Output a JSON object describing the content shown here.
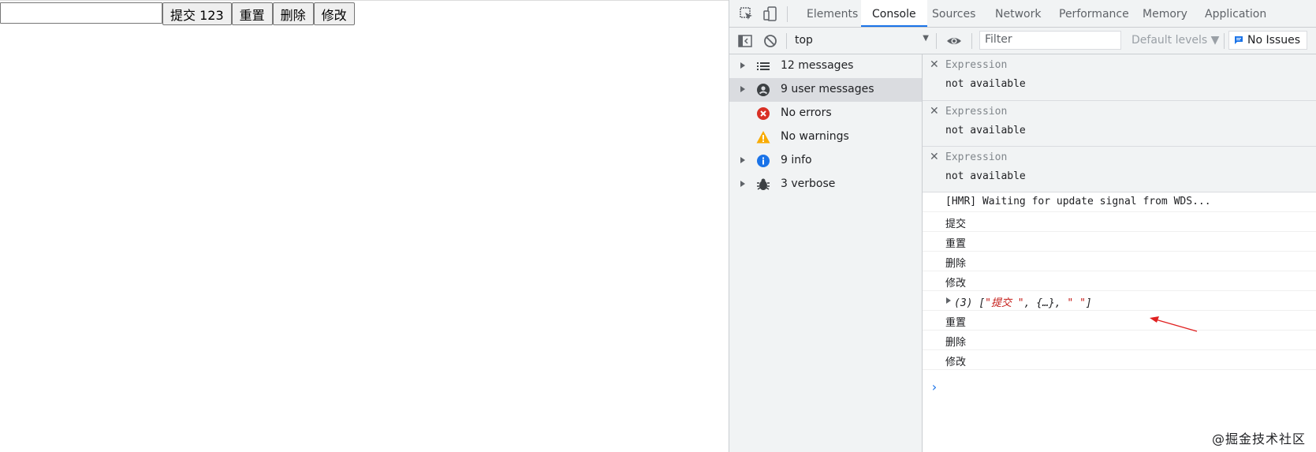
{
  "page": {
    "input_value": "",
    "buttons": [
      "提交 123",
      "重置",
      "删除",
      "修改"
    ]
  },
  "devtools": {
    "tabs": [
      "Elements",
      "Console",
      "Sources",
      "Network",
      "Performance",
      "Memory",
      "Application"
    ],
    "active_tab": "Console",
    "toolbar": {
      "context": "top",
      "filter_placeholder": "Filter",
      "levels": "Default levels ▼",
      "issues": "No Issues"
    },
    "sidebar": [
      {
        "label": "12 messages",
        "icon": "list-icon",
        "expandable": true,
        "selected": false
      },
      {
        "label": "9 user messages",
        "icon": "user-icon",
        "expandable": true,
        "selected": true
      },
      {
        "label": "No errors",
        "icon": "error-icon",
        "expandable": false,
        "selected": false
      },
      {
        "label": "No warnings",
        "icon": "warning-icon",
        "expandable": false,
        "selected": false
      },
      {
        "label": "9 info",
        "icon": "info-icon",
        "expandable": true,
        "selected": false
      },
      {
        "label": "3 verbose",
        "icon": "bug-icon",
        "expandable": true,
        "selected": false
      }
    ],
    "expressions": [
      {
        "label": "Expression",
        "value": "not available"
      },
      {
        "label": "Expression",
        "value": "not available"
      },
      {
        "label": "Expression",
        "value": "not available"
      }
    ],
    "messages": [
      "[HMR] Waiting for update signal from WDS...",
      "提交",
      "重置",
      "删除",
      "修改",
      {
        "count": "(3)",
        "open": "[",
        "s1": "\"提交 \"",
        "mid": ", {…}, ",
        "s2": "\" \"",
        "close": "]"
      },
      "重置",
      "删除",
      "修改"
    ],
    "prompt": "›"
  },
  "watermark": "@掘金技术社区",
  "colors": {
    "accent": "#1a73e8",
    "annotation_arrow": "#e02020",
    "error": "#d93025",
    "warning": "#f9ab00",
    "info": "#1a73e8"
  }
}
